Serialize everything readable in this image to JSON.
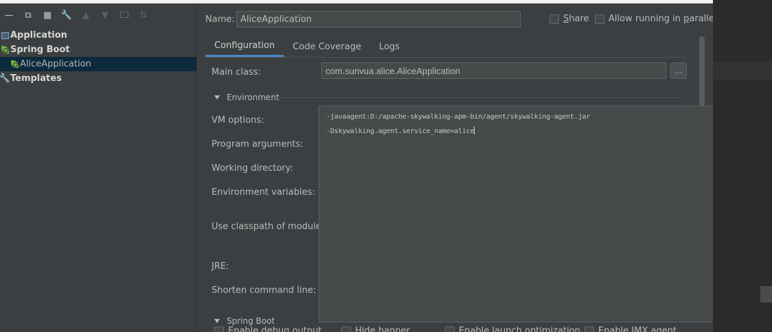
{
  "toolbar": {
    "icons": [
      "minus-icon",
      "copy-icon",
      "save-icon",
      "wrench-icon",
      "arrow-up-icon",
      "arrow-down-icon",
      "folder-add-icon",
      "sort-icon"
    ]
  },
  "tree": {
    "application": "Application",
    "spring_boot": "Spring Boot",
    "alice_application": "AliceApplication",
    "templates": "Templates"
  },
  "name": {
    "label": "Name:",
    "value": "AliceApplication"
  },
  "share": {
    "label_u": "S",
    "label_rest": "hare"
  },
  "parallel": {
    "label_a": "Allow running in ",
    "label_u": "p",
    "label_b": "arallel"
  },
  "tabs": [
    {
      "label": "Configuration",
      "active": true
    },
    {
      "label": "Code Coverage",
      "active": false
    },
    {
      "label": "Logs",
      "active": false
    }
  ],
  "main_class": {
    "label": "Main class:",
    "value": "com.sunvua.alice.AliceApplication",
    "browse": "..."
  },
  "environment": {
    "section": "Environment",
    "vm_options": "VM options:",
    "program_arguments": "Program arguments:",
    "working_directory": "Working directory:",
    "environment_variables": "Environment variables:",
    "classpath": "Use classpath of module:",
    "jre": "JRE:",
    "shorten": "Shorten command line:"
  },
  "vm_popup": {
    "line1": "-javaagent:D:/apache-skywalking-apm-bin/agent/skywalking-agent.jar",
    "line2": "-Dskywalking.agent.service_name=alice"
  },
  "spring_boot_section": "Spring Boot",
  "bottom": {
    "c1": "Enable debug output",
    "c2": "Hide banner",
    "c3": "Enable launch optimization",
    "c4": "Enable JMX agent"
  },
  "colors": {
    "accent": "#4a88c7",
    "selection": "#0d293e",
    "spring_green": "#6db33f"
  }
}
